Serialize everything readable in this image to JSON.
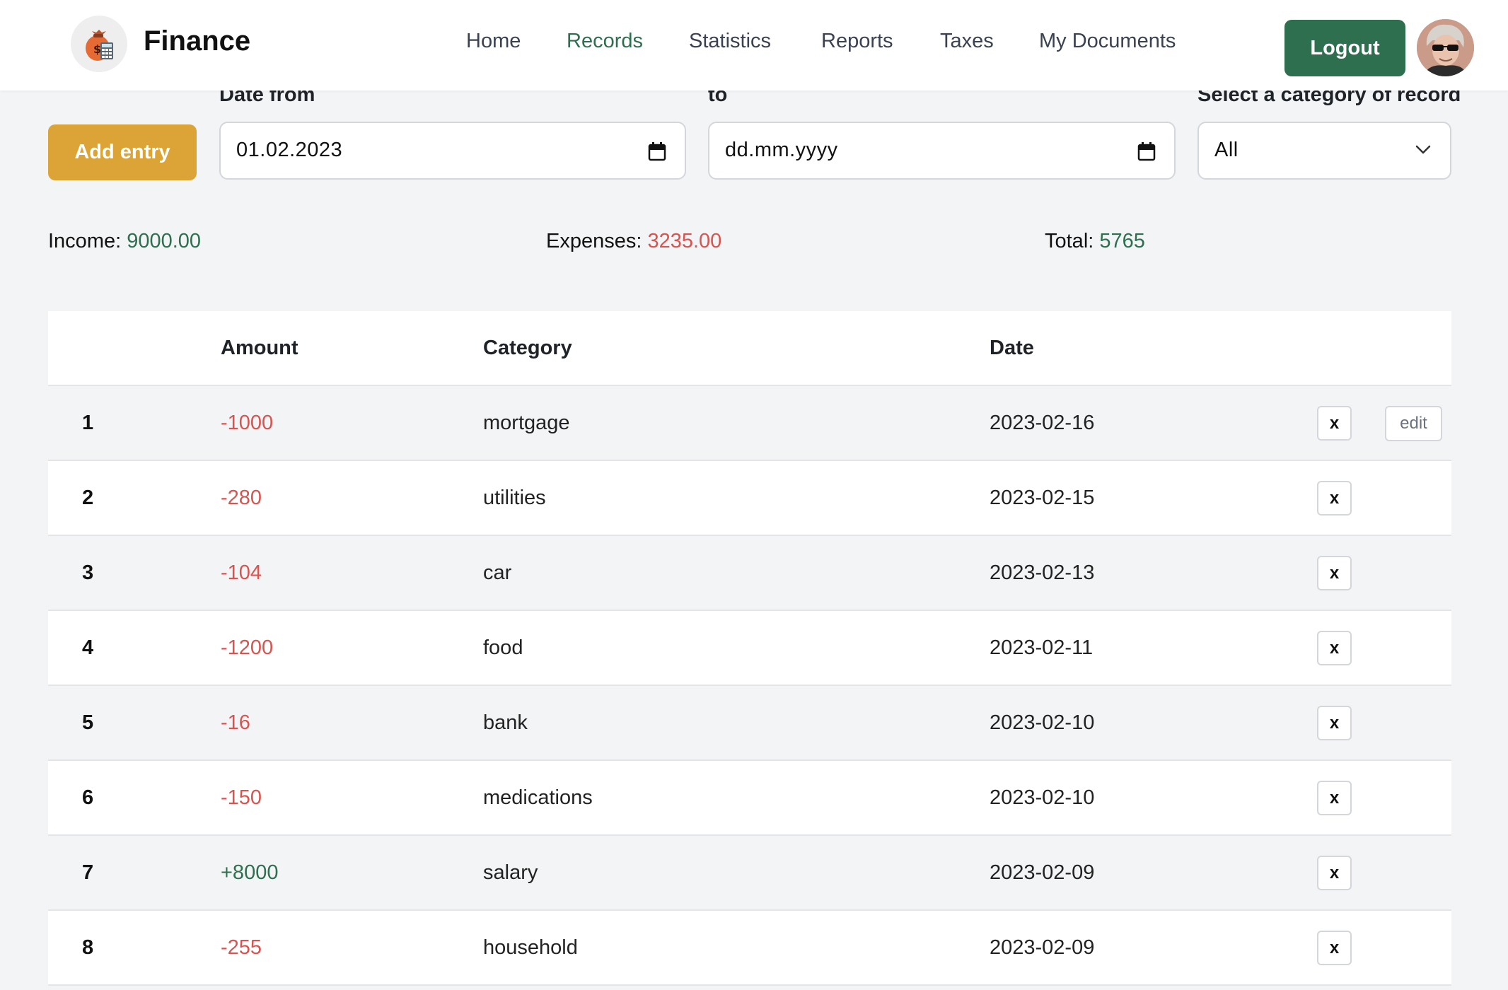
{
  "app": {
    "title": "Finance"
  },
  "nav": {
    "items": [
      {
        "label": "Home",
        "active": false
      },
      {
        "label": "Records",
        "active": true
      },
      {
        "label": "Statistics",
        "active": false
      },
      {
        "label": "Reports",
        "active": false
      },
      {
        "label": "Taxes",
        "active": false
      },
      {
        "label": "My Documents",
        "active": false
      }
    ],
    "logout_label": "Logout"
  },
  "filters": {
    "add_entry_label": "Add entry",
    "date_from_label": "Date from",
    "date_from_value": "01.02.2023",
    "date_to_label": "to",
    "date_to_value": "dd.mm.yyyy",
    "category_label": "Select a category of record",
    "category_value": "All"
  },
  "summary": {
    "income_label": "Income:",
    "income_value": "9000.00",
    "expenses_label": "Expenses:",
    "expenses_value": "3235.00",
    "total_label": "Total:",
    "total_value": "5765"
  },
  "table": {
    "headers": {
      "amount": "Amount",
      "category": "Category",
      "date": "Date"
    },
    "delete_label": "x",
    "edit_label": "edit",
    "rows": [
      {
        "index": "1",
        "amount": "-1000",
        "category": "mortgage",
        "date": "2023-02-16",
        "type": "expense",
        "show_edit": true
      },
      {
        "index": "2",
        "amount": "-280",
        "category": "utilities",
        "date": "2023-02-15",
        "type": "expense",
        "show_edit": false
      },
      {
        "index": "3",
        "amount": "-104",
        "category": "car",
        "date": "2023-02-13",
        "type": "expense",
        "show_edit": false
      },
      {
        "index": "4",
        "amount": "-1200",
        "category": "food",
        "date": "2023-02-11",
        "type": "expense",
        "show_edit": false
      },
      {
        "index": "5",
        "amount": "-16",
        "category": "bank",
        "date": "2023-02-10",
        "type": "expense",
        "show_edit": false
      },
      {
        "index": "6",
        "amount": "-150",
        "category": "medications",
        "date": "2023-02-10",
        "type": "expense",
        "show_edit": false
      },
      {
        "index": "7",
        "amount": "+8000",
        "category": "salary",
        "date": "2023-02-09",
        "type": "income",
        "show_edit": false
      },
      {
        "index": "8",
        "amount": "-255",
        "category": "household",
        "date": "2023-02-09",
        "type": "expense",
        "show_edit": false
      }
    ]
  },
  "icons": {
    "logo": "money-bag-calculator-icon",
    "date": "calendar-icon",
    "select": "chevron-down-icon",
    "avatar": "user-avatar"
  },
  "colors": {
    "accent_green": "#2e6f4f",
    "add_button": "#dca336",
    "expense_red": "#d9534f",
    "income_green": "#2e6f4f"
  }
}
